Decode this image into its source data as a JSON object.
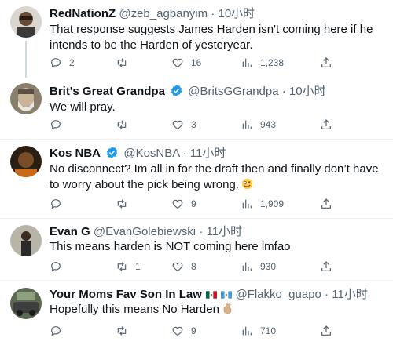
{
  "tweets": [
    {
      "name": "RedNationZ",
      "verified": false,
      "handle": "@zeb_agbanyim",
      "dot": "·",
      "time": "10小时",
      "text": "That response suggests James Harden isn't coming here if he intends to be the Harden of yesteryear.",
      "replies": "2",
      "retweets": "",
      "likes": "16",
      "views": "1,238"
    },
    {
      "name": "Brit's Great Grandpa",
      "verified": true,
      "handle": "@BritsGGrandpa",
      "dot": "·",
      "time": "10小时",
      "text": "We will pray.",
      "replies": "",
      "retweets": "",
      "likes": "3",
      "views": "943"
    },
    {
      "name": "Kos NBA",
      "verified": true,
      "handle": "@KosNBA",
      "dot": "·",
      "time": "11小时",
      "text": "No disconnect? Im all in for the draft then and finally don’t have to worry about the pick being wrong.",
      "emoji": "zany-face",
      "replies": "",
      "retweets": "",
      "likes": "9",
      "views": "1,909"
    },
    {
      "name": "Evan G",
      "verified": false,
      "handle": "@EvanGolebiewski",
      "dot": "·",
      "time": "11小时",
      "text": "This means harden is NOT coming here lmfao",
      "replies": "",
      "retweets": "1",
      "likes": "8",
      "views": "930"
    },
    {
      "name": "Your Moms Fav Son In Law",
      "verified": false,
      "flags": [
        "mexico-flag",
        "guatemala-flag"
      ],
      "handle": "@Flakko_guapo",
      "dot": "·",
      "time": "11小时",
      "text": "Hopefully this means No Harden",
      "emoji": "crossed-fingers",
      "replies": "",
      "retweets": "",
      "likes": "9",
      "views": "710"
    }
  ],
  "icons": {
    "reply": "reply-icon",
    "retweet": "retweet-icon",
    "like": "heart-icon",
    "views": "views-bar-chart-icon",
    "share": "share-icon",
    "verified": "verified-badge-icon"
  },
  "colors": {
    "text": "#0f1419",
    "secondary": "#536471",
    "verified": "#1d9bf0",
    "divider": "#eff3f4",
    "thread_line": "#cfd9de"
  }
}
